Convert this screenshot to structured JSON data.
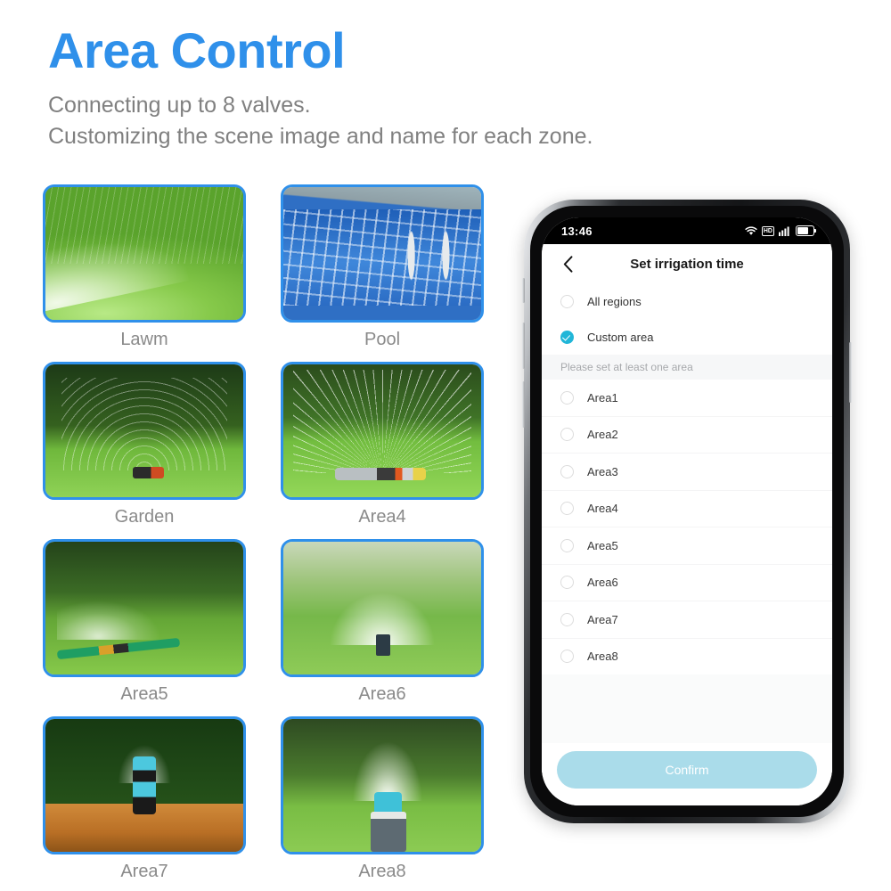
{
  "header": {
    "title": "Area Control",
    "sub_line1": "Connecting up to 8 valves.",
    "sub_line2": "Customizing the scene image and name for each zone.",
    "title_color": "#2f90ea",
    "sub_color": "#808080"
  },
  "grid": {
    "cards": [
      {
        "label": "Lawm",
        "scene": "sc-lawn"
      },
      {
        "label": "Pool",
        "scene": "sc-pool"
      },
      {
        "label": "Garden",
        "scene": "sc-garden"
      },
      {
        "label": "Area4",
        "scene": "sc-fan"
      },
      {
        "label": "Area5",
        "scene": "sc-spray"
      },
      {
        "label": "Area6",
        "scene": "sc-mist"
      },
      {
        "label": "Area7",
        "scene": "sc-noz"
      },
      {
        "label": "Area8",
        "scene": "sc-noz2"
      }
    ]
  },
  "phone": {
    "statusbar": {
      "time": "13:46",
      "wifi_icon": "wifi-icon",
      "hd_badge": "HD",
      "signal_icon": "signal-bars-icon",
      "battery_icon": "battery-icon"
    },
    "navbar": {
      "back_icon": "chevron-left-icon",
      "title": "Set irrigation time"
    },
    "options": [
      {
        "label": "All regions",
        "checked": false
      },
      {
        "label": "Custom area",
        "checked": true
      }
    ],
    "hint": "Please set at least one area",
    "areas": [
      {
        "label": "Area1",
        "checked": false
      },
      {
        "label": "Area2",
        "checked": false
      },
      {
        "label": "Area3",
        "checked": false
      },
      {
        "label": "Area4",
        "checked": false
      },
      {
        "label": "Area5",
        "checked": false
      },
      {
        "label": "Area6",
        "checked": false
      },
      {
        "label": "Area7",
        "checked": false
      },
      {
        "label": "Area8",
        "checked": false
      }
    ],
    "confirm_label": "Confirm",
    "accent_color": "#21b6d8",
    "confirm_color": "#aadcea"
  }
}
